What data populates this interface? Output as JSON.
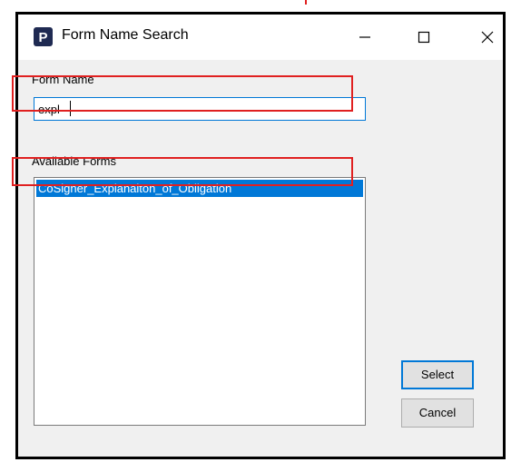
{
  "window": {
    "title": "Form Name Search",
    "app_icon_letter": "P",
    "app_icon_color": "#1f2a52",
    "controls": [
      "minimize-icon",
      "maximize-icon",
      "close-icon"
    ]
  },
  "form": {
    "form_name_label": "Form Name",
    "form_name_value": "expl",
    "available_forms_label": "Available Forms",
    "available_forms": [
      {
        "label": "CoSigner_Explanaiton_of_Obligation",
        "selected": true
      }
    ]
  },
  "buttons": {
    "select_label": "Select",
    "cancel_label": "Cancel"
  },
  "colors": {
    "selection": "#0078d7",
    "highlight_annotation": "#e02020",
    "dialog_background": "#f0f0f0"
  }
}
